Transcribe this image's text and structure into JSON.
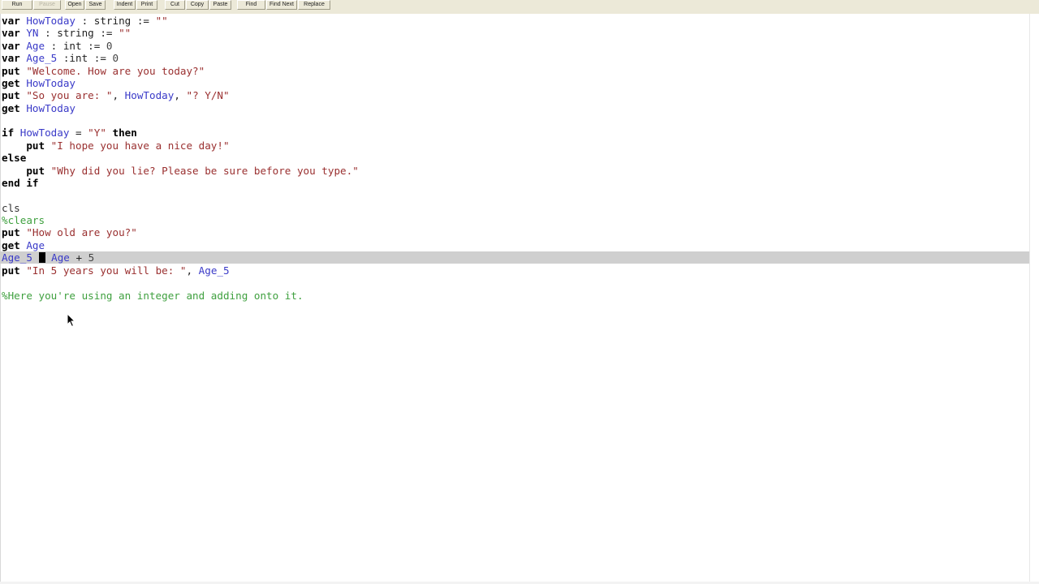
{
  "toolbar": {
    "run": "Run",
    "pause": "Pause",
    "open": "Open",
    "save": "Save",
    "indent": "Indent",
    "print": "Print",
    "cut": "Cut",
    "copy": "Copy",
    "paste": "Paste",
    "find": "Find",
    "find_next": "Find Next",
    "replace": "Replace"
  },
  "code": {
    "l1": {
      "a": "var ",
      "b": "HowToday",
      "c": " : string := ",
      "d": "\"\""
    },
    "l2": {
      "a": "var ",
      "b": "YN",
      "c": " : string := ",
      "d": "\"\""
    },
    "l3": {
      "a": "var ",
      "b": "Age",
      "c": " : int := ",
      "d": "0"
    },
    "l4": {
      "a": "var ",
      "b": "Age_5",
      "c": " :int := ",
      "d": "0"
    },
    "l5": {
      "a": "put ",
      "b": "\"Welcome. How are you today?\""
    },
    "l6": {
      "a": "get ",
      "b": "HowToday"
    },
    "l7": {
      "a": "put ",
      "b": "\"So you are: \"",
      "c": ", ",
      "d": "HowToday",
      "e": ", ",
      "f": "\"? Y/N\""
    },
    "l8": {
      "a": "get ",
      "b": "HowToday"
    },
    "l10": {
      "a": "if ",
      "b": "HowToday",
      "c": " = ",
      "d": "\"Y\"",
      "e": " then"
    },
    "l11": {
      "a": "    put ",
      "b": "\"I hope you have a nice day!\""
    },
    "l12": {
      "a": "else"
    },
    "l13": {
      "a": "    put ",
      "b": "\"Why did you lie? Please be sure before you type.\""
    },
    "l14": {
      "a": "end if"
    },
    "l16": {
      "a": "cls"
    },
    "l17": {
      "a": "%clears"
    },
    "l18": {
      "a": "put ",
      "b": "\"How old are you?\""
    },
    "l19": {
      "a": "get ",
      "b": "Age"
    },
    "l20": {
      "a": "Age_5",
      "b": " ",
      "c": " ",
      "d": "Age",
      "e": " + ",
      "f": "5"
    },
    "l21": {
      "a": "put ",
      "b": "\"In 5 years you will be: \"",
      "c": ", ",
      "d": "Age_5"
    },
    "l23": {
      "a": "%Here you're using an integer and adding onto it."
    }
  },
  "colors": {
    "keyword": "#000000",
    "identifier": "#3a3ac8",
    "string": "#9a3030",
    "comment": "#3fa03f",
    "highlight_row": "#cfcfcf"
  }
}
